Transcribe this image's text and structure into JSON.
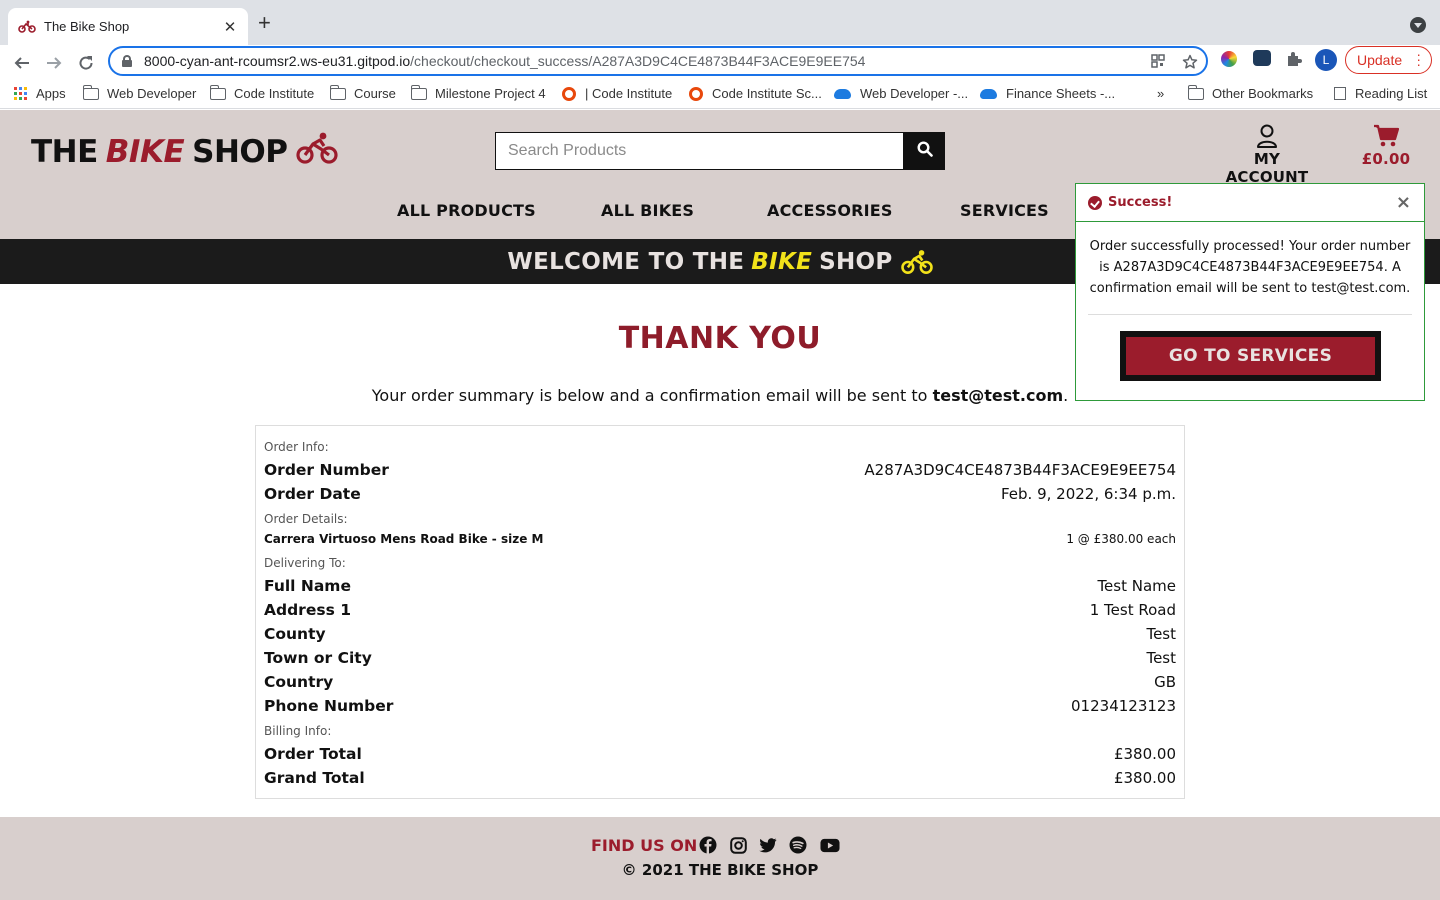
{
  "browser": {
    "tab_title": "The Bike Shop",
    "url_host": "8000-cyan-ant-rcoumsr2.ws-eu31.gitpod.io",
    "url_path": "/checkout/checkout_success/A287A3D9C4CE4873B44F3ACE9E9EE754",
    "update_label": "Update",
    "profile_initial": "L",
    "bookmarks": [
      "Apps",
      "Web Developer",
      "Code Institute",
      "Course",
      "Milestone Project 4",
      "| Code Institute",
      "Code Institute Sc...",
      "Web Developer -...",
      "Finance Sheets -...",
      "Other Bookmarks",
      "Reading List"
    ],
    "overflow_label": "»"
  },
  "header": {
    "logo_left": "THE",
    "logo_mid": "BIKE",
    "logo_right": "SHOP",
    "search_placeholder": "Search Products",
    "account_label": "MY ACCOUNT",
    "cart_total": "£0.00",
    "nav": [
      "ALL PRODUCTS",
      "ALL BIKES",
      "ACCESSORIES",
      "SERVICES"
    ]
  },
  "banner": {
    "left": "WELCOME TO THE",
    "mid": "BIKE",
    "right": "SHOP"
  },
  "content": {
    "title": "THANK YOU",
    "summary_prefix": "Your order summary is below and a confirmation email will be sent to",
    "summary_email": "test@test.com",
    "summary_suffix": ".",
    "order_info_label": "Order Info:",
    "order_number_label": "Order Number",
    "order_number": "A287A3D9C4CE4873B44F3ACE9E9EE754",
    "order_date_label": "Order Date",
    "order_date": "Feb. 9, 2022, 6:34 p.m.",
    "order_details_label": "Order Details:",
    "item_name": "Carrera Virtuoso Mens Road Bike - size M",
    "item_qty": "1 @ £380.00 each",
    "delivering_label": "Delivering To:",
    "delivery": [
      {
        "label": "Full Name",
        "value": "Test Name"
      },
      {
        "label": "Address 1",
        "value": "1 Test Road"
      },
      {
        "label": "County",
        "value": "Test"
      },
      {
        "label": "Town or City",
        "value": "Test"
      },
      {
        "label": "Country",
        "value": "GB"
      },
      {
        "label": "Phone Number",
        "value": "01234123123"
      }
    ],
    "billing_label": "Billing Info:",
    "order_total_label": "Order Total",
    "order_total": "£380.00",
    "grand_total_label": "Grand Total",
    "grand_total": "£380.00"
  },
  "toast": {
    "title": "Success!",
    "message": "Order successfully processed! Your order number is A287A3D9C4CE4873B44F3ACE9E9EE754. A confirmation email will be sent to test@test.com.",
    "button": "GO TO SERVICES",
    "close": "×"
  },
  "footer": {
    "find_us": "FIND US ON",
    "copyright": "© 2021 THE BIKE SHOP"
  },
  "colors": {
    "brand_red": "#9b1c2c",
    "header_bg": "#d8cfcd",
    "banner_bg": "#1b1b1b",
    "banner_accent": "#f2e21a",
    "toast_border": "#2e9a3a"
  }
}
